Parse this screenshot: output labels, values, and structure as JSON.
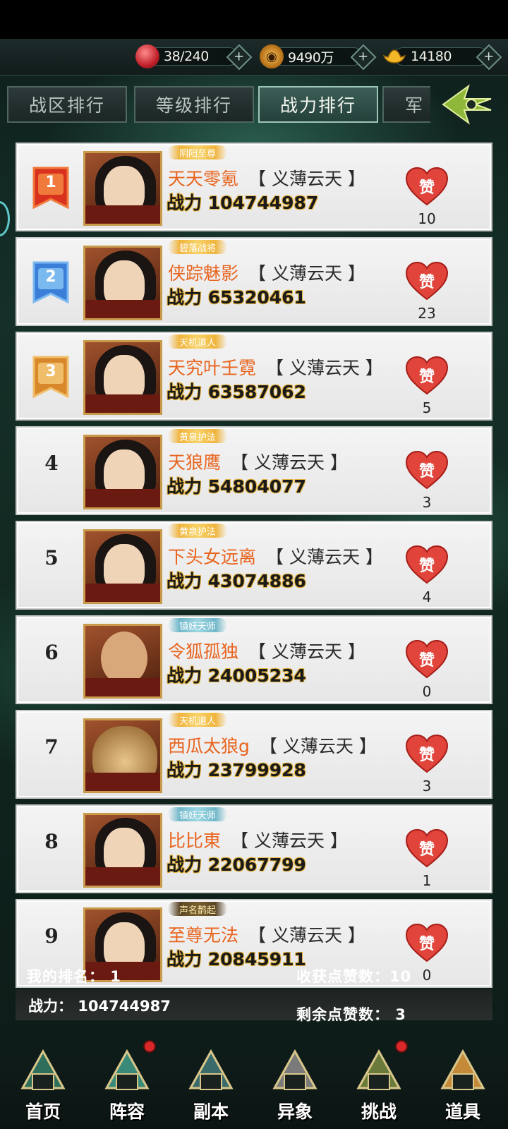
{
  "resources": [
    {
      "icon": "red-orb-icon",
      "value": "38/240"
    },
    {
      "icon": "copper-coin-icon",
      "value": "9490万"
    },
    {
      "icon": "gold-ingot-icon",
      "value": "14180"
    }
  ],
  "tabs": [
    {
      "label": "战区排行",
      "active": false
    },
    {
      "label": "等级排行",
      "active": false
    },
    {
      "label": "战力排行",
      "active": true
    },
    {
      "label": "军",
      "active": false
    }
  ],
  "power_prefix": "战力",
  "like_label": "赞",
  "ranking": [
    {
      "rank": "1",
      "title": "阴阳至尊",
      "name": "天天零氪",
      "guild": "【 义薄云天 】",
      "power": "104744987",
      "likes": "10"
    },
    {
      "rank": "2",
      "title": "碧落战将",
      "name": "侠踪魅影",
      "guild": "【 义薄云天 】",
      "power": "65320461",
      "likes": "23"
    },
    {
      "rank": "3",
      "title": "天机道人",
      "name": "天究叶壬霓",
      "guild": "【 义薄云天 】",
      "power": "63587062",
      "likes": "5"
    },
    {
      "rank": "4",
      "title": "黄泉护法",
      "name": "天狼鹰",
      "guild": "【 义薄云天 】",
      "power": "54804077",
      "likes": "3"
    },
    {
      "rank": "5",
      "title": "黄泉护法",
      "name": "下头女远离",
      "guild": "【 义薄云天 】",
      "power": "43074886",
      "likes": "4"
    },
    {
      "rank": "6",
      "title": "镇妖天师",
      "name": "令狐孤独",
      "guild": "【 义薄云天 】",
      "power": "24005234",
      "likes": "0"
    },
    {
      "rank": "7",
      "title": "天机道人",
      "name": "西瓜太狼g",
      "guild": "【 义薄云天 】",
      "power": "23799928",
      "likes": "3"
    },
    {
      "rank": "8",
      "title": "镇妖天师",
      "name": "比比東",
      "guild": "【 义薄云天 】",
      "power": "22067799",
      "likes": "1"
    },
    {
      "rank": "9",
      "title": "声名鹊起",
      "name": "至尊无法",
      "guild": "【 义薄云天 】",
      "power": "20845911",
      "likes": "0"
    }
  ],
  "my_info": {
    "rank_text": "我的排名： 1",
    "received_text": "收获点赞数：10",
    "power_text": "战力： 104744987",
    "remaining_text": "剩余点赞数： 3"
  },
  "nav": [
    {
      "label": "首页",
      "icon": "pavilion-icon",
      "dot": false
    },
    {
      "label": "阵容",
      "icon": "book-icon",
      "dot": true
    },
    {
      "label": "副本",
      "icon": "sword-icon",
      "dot": false
    },
    {
      "label": "异象",
      "icon": "crossed-swords-icon",
      "dot": false
    },
    {
      "label": "挑战",
      "icon": "scroll-icon",
      "dot": true
    },
    {
      "label": "道具",
      "icon": "bag-icon",
      "dot": false
    }
  ]
}
